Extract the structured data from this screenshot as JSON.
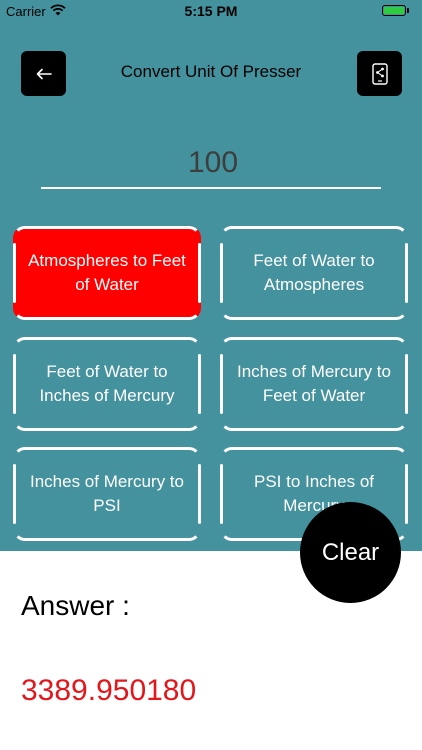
{
  "status_bar": {
    "carrier": "Carrier",
    "time": "5:15 PM",
    "wifi_icon": "wifi-icon",
    "battery_icon": "battery-icon"
  },
  "header": {
    "title": "Convert Unit Of Presser",
    "back_icon": "arrow-left-icon",
    "share_icon": "phone-share-icon"
  },
  "input": {
    "value": "100"
  },
  "conversions": [
    {
      "label": "Atmospheres to Feet of Water",
      "selected": true
    },
    {
      "label": "Feet of Water to Atmospheres",
      "selected": false
    },
    {
      "label": "Feet of Water to Inches of Mercury",
      "selected": false
    },
    {
      "label": "Inches of Mercury to Feet of Water",
      "selected": false
    },
    {
      "label": "Inches of Mercury to PSI",
      "selected": false
    },
    {
      "label": "PSI to Inches of Mercury",
      "selected": false
    }
  ],
  "clear_label": "Clear",
  "answer": {
    "label": "Answer :",
    "value": "3389.950180"
  },
  "colors": {
    "background_top": "#44929e",
    "selected_button": "#ff0000",
    "answer_value": "#e3161b"
  }
}
